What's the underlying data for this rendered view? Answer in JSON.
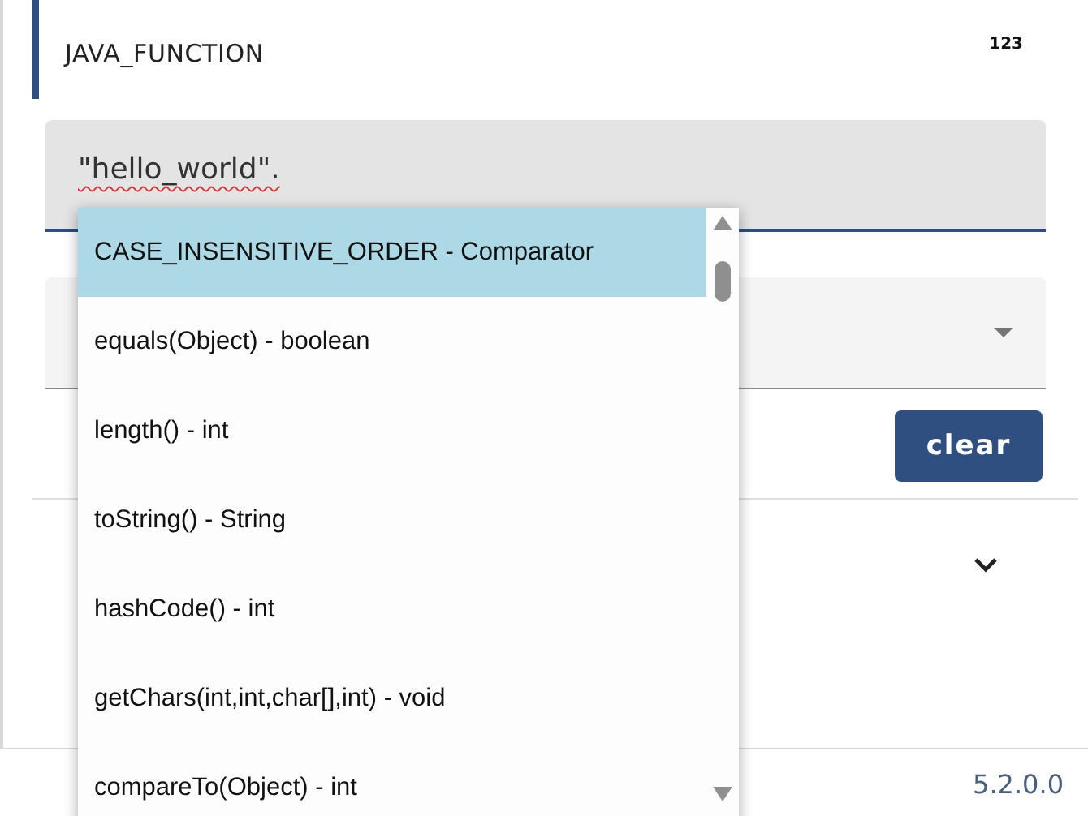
{
  "panel": {
    "title": "JAVA_FUNCTION",
    "type_badge": "123"
  },
  "expression_field": {
    "value": "\"hello_world\"."
  },
  "clear_button": {
    "label": "clear"
  },
  "collapsed_section": {
    "expanded": false
  },
  "version": "5.2.0.0",
  "autocomplete": {
    "items": [
      {
        "label": "CASE_INSENSITIVE_ORDER - Comparator",
        "selected": true
      },
      {
        "label": "equals(Object) - boolean",
        "selected": false
      },
      {
        "label": "length() - int",
        "selected": false
      },
      {
        "label": "toString() - String",
        "selected": false
      },
      {
        "label": "hashCode() - int",
        "selected": false
      },
      {
        "label": "getChars(int,int,char[],int) - void",
        "selected": false
      },
      {
        "label": "compareTo(Object) - int",
        "selected": false
      }
    ]
  }
}
